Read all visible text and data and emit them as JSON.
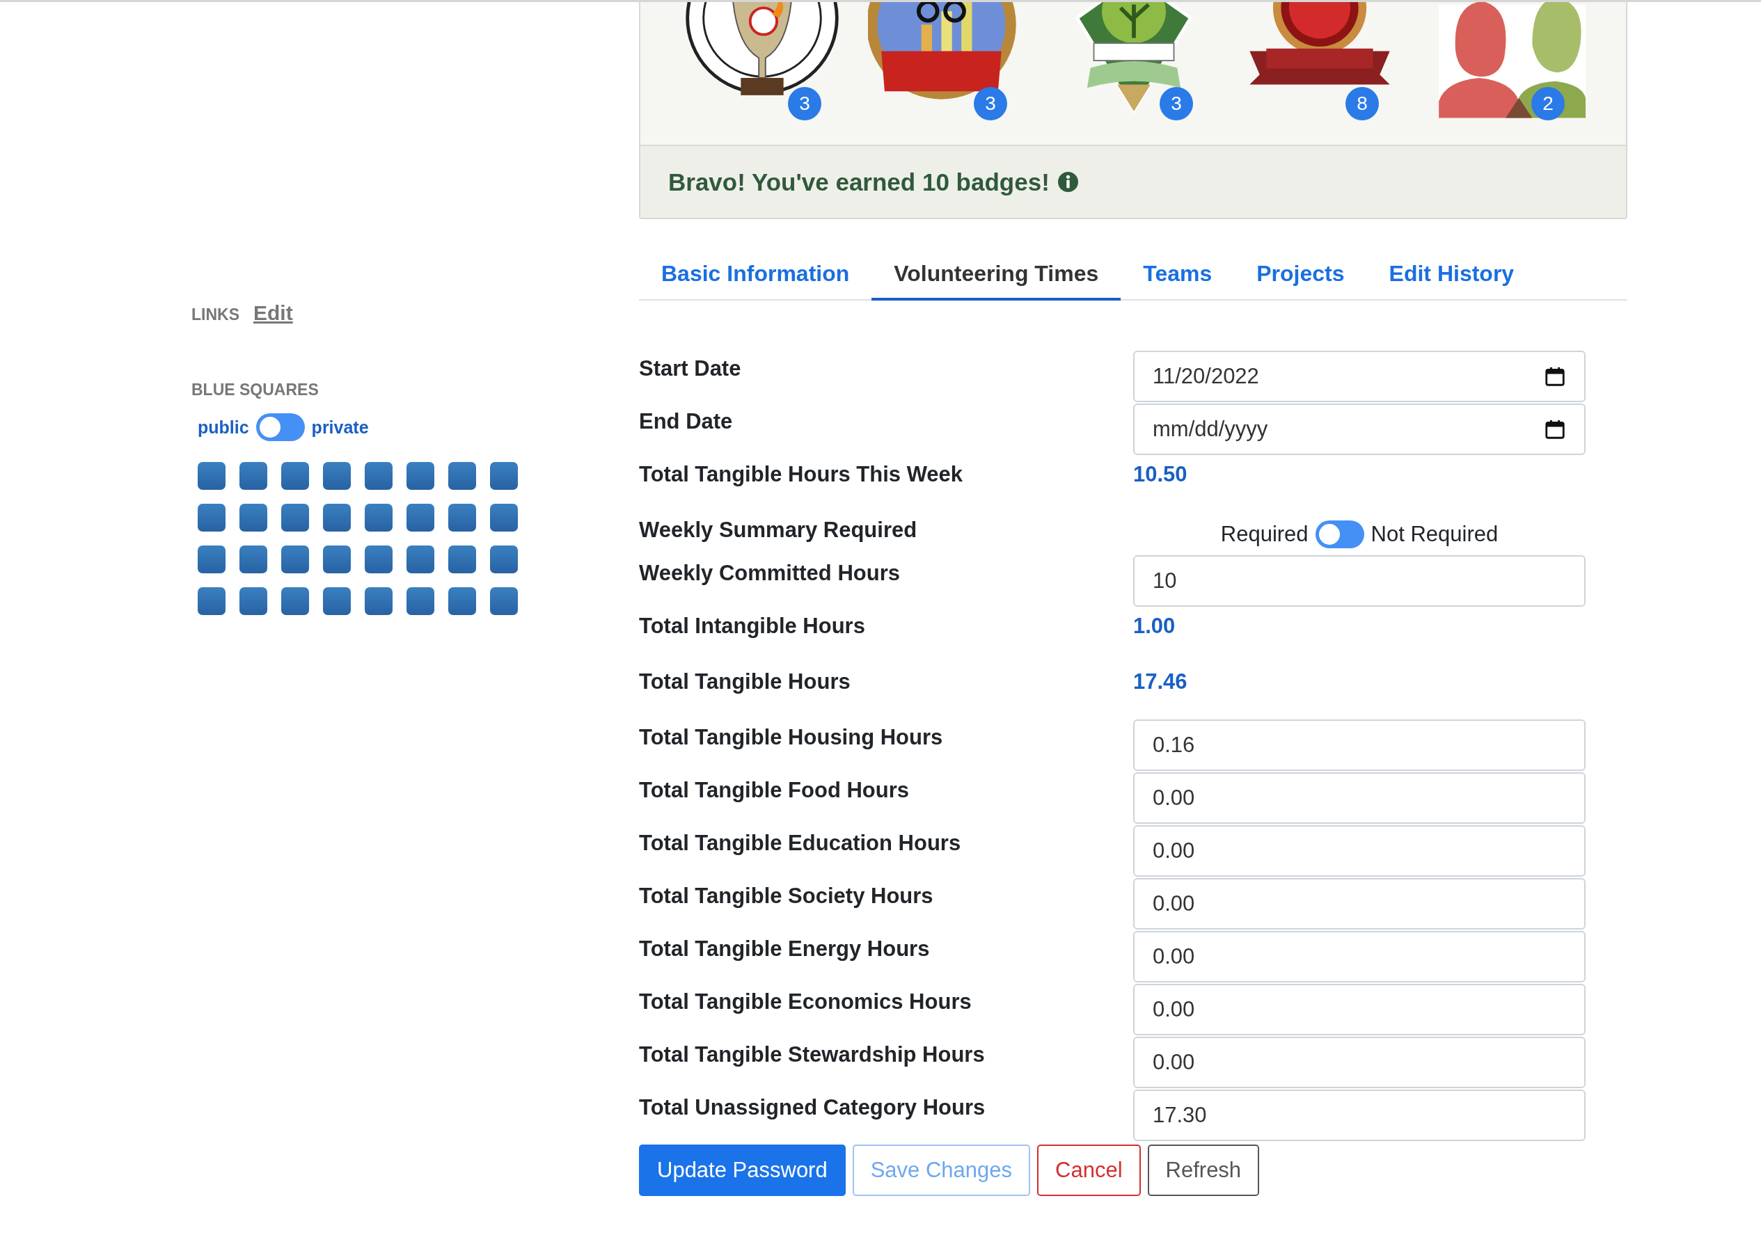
{
  "badges": [
    {
      "kind": "trophy",
      "count": "3"
    },
    {
      "kind": "medal",
      "count": "3"
    },
    {
      "kind": "shield",
      "count": "3"
    },
    {
      "kind": "clock",
      "count": "8"
    },
    {
      "kind": "people",
      "count": "2"
    }
  ],
  "badge_message": "Bravo! You've earned 10 badges!",
  "links": {
    "heading": "LINKS",
    "edit": "Edit"
  },
  "blue_squares": {
    "heading": "BLUE SQUARES",
    "toggle": {
      "left": "public",
      "right": "private",
      "checked": false
    },
    "squares": [
      {
        "kind": "square"
      },
      {
        "kind": "square"
      },
      {
        "kind": "square"
      },
      {
        "kind": "square"
      },
      {
        "kind": "square"
      },
      {
        "kind": "square"
      },
      {
        "kind": "square"
      },
      {
        "kind": "square"
      },
      {
        "kind": "square"
      },
      {
        "kind": "square"
      },
      {
        "kind": "square"
      },
      {
        "kind": "square"
      },
      {
        "kind": "square"
      },
      {
        "kind": "square"
      },
      {
        "kind": "square"
      },
      {
        "kind": "square"
      },
      {
        "kind": "square"
      },
      {
        "kind": "square"
      },
      {
        "kind": "square"
      },
      {
        "kind": "square"
      },
      {
        "kind": "square"
      },
      {
        "kind": "square"
      },
      {
        "kind": "square"
      },
      {
        "kind": "square"
      },
      {
        "kind": "square"
      },
      {
        "kind": "square"
      },
      {
        "kind": "square"
      },
      {
        "kind": "square"
      },
      {
        "kind": "square"
      },
      {
        "kind": "square"
      },
      {
        "kind": "square"
      },
      {
        "kind": "square"
      }
    ]
  },
  "tabs": [
    {
      "label": "Basic Information",
      "selected": false
    },
    {
      "label": "Volunteering Times",
      "selected": true
    },
    {
      "label": "Teams",
      "selected": false
    },
    {
      "label": "Projects",
      "selected": false
    },
    {
      "label": "Edit History",
      "selected": false
    }
  ],
  "form": [
    {
      "kind": "date",
      "label": "Start Date",
      "value": "11/20/2022"
    },
    {
      "kind": "date",
      "label": "End Date",
      "placeholder": "mm/dd/yyyy"
    },
    {
      "kind": "value",
      "label": "Total Tangible Hours This Week",
      "value": "10.50"
    },
    {
      "kind": "toggle",
      "label": "Weekly Summary Required",
      "left": "Required",
      "right": "Not Required",
      "checked": false
    },
    {
      "kind": "input",
      "label": "Weekly Committed Hours",
      "value": "10"
    },
    {
      "kind": "value",
      "label": "Total Intangible Hours",
      "value": "1.00"
    },
    {
      "kind": "value",
      "label": "Total Tangible Hours",
      "value": "17.46"
    },
    {
      "kind": "input",
      "label": "Total Tangible Housing Hours",
      "value": "0.16"
    },
    {
      "kind": "input",
      "label": "Total Tangible Food Hours",
      "value": "0.00"
    },
    {
      "kind": "input",
      "label": "Total Tangible Education Hours",
      "value": "0.00"
    },
    {
      "kind": "input",
      "label": "Total Tangible Society Hours",
      "value": "0.00"
    },
    {
      "kind": "input",
      "label": "Total Tangible Energy Hours",
      "value": "0.00"
    },
    {
      "kind": "input",
      "label": "Total Tangible Economics Hours",
      "value": "0.00"
    },
    {
      "kind": "input",
      "label": "Total Tangible Stewardship Hours",
      "value": "0.00"
    },
    {
      "kind": "input",
      "label": "Total Unassigned Category Hours",
      "value": "17.30"
    }
  ],
  "buttons": [
    {
      "kind": "primary",
      "label": "Update Password"
    },
    {
      "kind": "info",
      "label": "Save Changes"
    },
    {
      "kind": "danger",
      "label": "Cancel"
    },
    {
      "kind": "secondary",
      "label": "Refresh"
    }
  ]
}
